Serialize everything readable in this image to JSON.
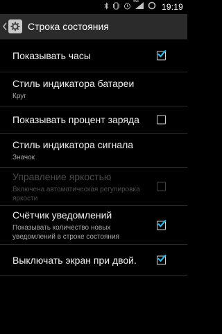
{
  "status_bar": {
    "network_type": "4G",
    "time": "19:19",
    "icons": [
      "bluetooth-icon",
      "vibrate-icon",
      "alarm-icon",
      "signal-icon",
      "battery-icon"
    ]
  },
  "action_bar": {
    "title": "Строка состояния",
    "app_icon": "gear-icon"
  },
  "settings": [
    {
      "title": "Показывать часы",
      "summary": "",
      "control": "checkbox",
      "checked": true,
      "enabled": true
    },
    {
      "title": "Стиль индикатора батареи",
      "summary": "Круг",
      "control": "none",
      "enabled": true
    },
    {
      "title": "Показывать процент заряда",
      "summary": "",
      "control": "checkbox",
      "checked": false,
      "enabled": true
    },
    {
      "title": "Стиль индикатора сигнала",
      "summary": "Значок",
      "control": "none",
      "enabled": true
    },
    {
      "title": "Управление яркостью",
      "summary": "Включена автоматическая регулировка яркости",
      "control": "checkbox",
      "checked": false,
      "enabled": false
    },
    {
      "title": "Счётчик уведомлений",
      "summary": "Показывать количество новых уведомлений в строке состояния",
      "control": "checkbox",
      "checked": true,
      "enabled": true
    },
    {
      "title": "Выключать экран при двой.",
      "summary": "",
      "control": "checkbox",
      "checked": true,
      "enabled": true
    }
  ],
  "colors": {
    "accent": "#33b5e5",
    "action_bar": "#2b2b2b",
    "background": "#000000"
  }
}
